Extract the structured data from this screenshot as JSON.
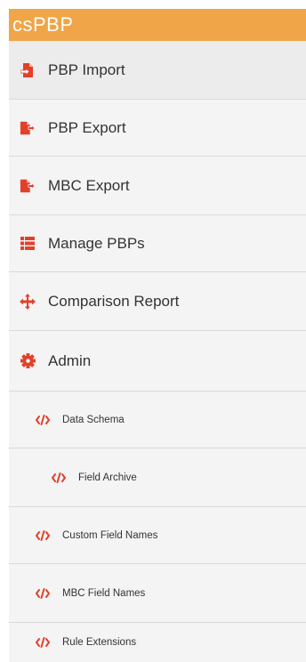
{
  "app": {
    "title": "csPBP"
  },
  "colors": {
    "accent": "#f0a548",
    "icon": "#e3402a"
  },
  "menu": {
    "items": [
      {
        "label": "PBP Import",
        "icon": "file-import-icon"
      },
      {
        "label": "PBP Export",
        "icon": "file-export-icon"
      },
      {
        "label": "MBC Export",
        "icon": "file-export-icon"
      },
      {
        "label": "Manage PBPs",
        "icon": "list-icon"
      },
      {
        "label": "Comparison Report",
        "icon": "arrows-move-icon"
      },
      {
        "label": "Admin",
        "icon": "gear-icon"
      }
    ],
    "admin_items": [
      {
        "label": "Data Schema",
        "icon": "code-icon"
      },
      {
        "label": "Field Archive",
        "icon": "code-icon"
      },
      {
        "label": "Custom Field Names",
        "icon": "code-icon"
      },
      {
        "label": "MBC Field Names",
        "icon": "code-icon"
      },
      {
        "label": "Rule Extensions",
        "icon": "code-icon"
      }
    ]
  }
}
